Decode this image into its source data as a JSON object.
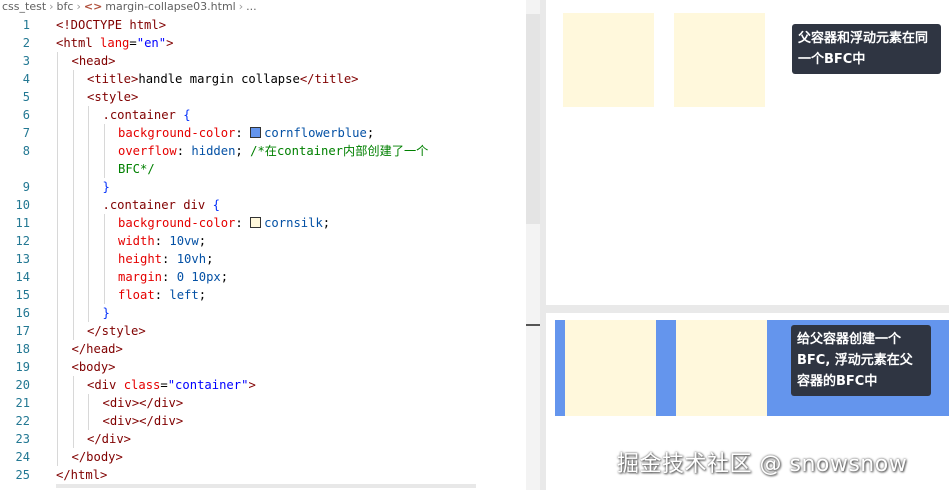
{
  "breadcrumb": {
    "items": [
      "css_test",
      "bfc",
      "margin-collapse03.html",
      "..."
    ],
    "file_icon": "<>"
  },
  "code_lines": [
    {
      "n": "1",
      "tokens": [
        [
          "tag",
          "<!DOCTYPE html>"
        ]
      ]
    },
    {
      "n": "2",
      "tokens": [
        [
          "tag",
          "<html "
        ],
        [
          "attr",
          "lang"
        ],
        [
          "pun",
          "="
        ],
        [
          "str",
          "\"en\""
        ],
        [
          "tag",
          ">"
        ]
      ]
    },
    {
      "n": "3",
      "tokens": [
        [
          "tag",
          "<head>"
        ]
      ]
    },
    {
      "n": "4",
      "tokens": [
        [
          "tag",
          "<title>"
        ],
        [
          "pun",
          "handle margin collapse"
        ],
        [
          "tag",
          "</title>"
        ]
      ]
    },
    {
      "n": "5",
      "tokens": [
        [
          "tag",
          "<style>"
        ]
      ]
    },
    {
      "n": "6",
      "tokens": [
        [
          "sel",
          ".container "
        ],
        [
          "brk",
          "{"
        ]
      ]
    },
    {
      "n": "7",
      "tokens": [
        [
          "prop",
          "background-color"
        ],
        [
          "pun",
          ": "
        ],
        [
          "swatch",
          "#6495ed"
        ],
        [
          "val",
          "cornflowerblue"
        ],
        [
          "pun",
          ";"
        ]
      ]
    },
    {
      "n": "8",
      "tokens": [
        [
          "prop",
          "overflow"
        ],
        [
          "pun",
          ": "
        ],
        [
          "val",
          "hidden"
        ],
        [
          "pun",
          "; "
        ],
        [
          "com",
          "/*在container内部创建了一个"
        ]
      ]
    },
    {
      "n": "",
      "tokens": [
        [
          "com",
          "BFC*/"
        ]
      ]
    },
    {
      "n": "9",
      "tokens": [
        [
          "brk",
          "}"
        ]
      ]
    },
    {
      "n": "10",
      "tokens": [
        [
          "sel",
          ".container div "
        ],
        [
          "brk",
          "{"
        ]
      ]
    },
    {
      "n": "11",
      "tokens": [
        [
          "prop",
          "background-color"
        ],
        [
          "pun",
          ": "
        ],
        [
          "swatch",
          "#fff8dc"
        ],
        [
          "val",
          "cornsilk"
        ],
        [
          "pun",
          ";"
        ]
      ]
    },
    {
      "n": "12",
      "tokens": [
        [
          "prop",
          "width"
        ],
        [
          "pun",
          ": "
        ],
        [
          "val",
          "10vw"
        ],
        [
          "pun",
          ";"
        ]
      ]
    },
    {
      "n": "13",
      "tokens": [
        [
          "prop",
          "height"
        ],
        [
          "pun",
          ": "
        ],
        [
          "val",
          "10vh"
        ],
        [
          "pun",
          ";"
        ]
      ]
    },
    {
      "n": "14",
      "tokens": [
        [
          "prop",
          "margin"
        ],
        [
          "pun",
          ": "
        ],
        [
          "val",
          "0 10px"
        ],
        [
          "pun",
          ";"
        ]
      ]
    },
    {
      "n": "15",
      "tokens": [
        [
          "prop",
          "float"
        ],
        [
          "pun",
          ": "
        ],
        [
          "val",
          "left"
        ],
        [
          "pun",
          ";"
        ]
      ]
    },
    {
      "n": "16",
      "tokens": [
        [
          "brk",
          "}"
        ]
      ]
    },
    {
      "n": "17",
      "tokens": [
        [
          "tag",
          "</style>"
        ]
      ]
    },
    {
      "n": "18",
      "tokens": [
        [
          "tag",
          "</head>"
        ]
      ]
    },
    {
      "n": "19",
      "tokens": [
        [
          "tag",
          "<body>"
        ]
      ]
    },
    {
      "n": "20",
      "tokens": [
        [
          "tag",
          "<div "
        ],
        [
          "attr",
          "class"
        ],
        [
          "pun",
          "="
        ],
        [
          "str",
          "\"container\""
        ],
        [
          "tag",
          ">"
        ]
      ]
    },
    {
      "n": "21",
      "tokens": [
        [
          "tag",
          "<div></div>"
        ]
      ]
    },
    {
      "n": "22",
      "tokens": [
        [
          "tag",
          "<div></div>"
        ]
      ]
    },
    {
      "n": "23",
      "tokens": [
        [
          "tag",
          "</div>"
        ]
      ]
    },
    {
      "n": "24",
      "tokens": [
        [
          "tag",
          "</body>"
        ]
      ]
    },
    {
      "n": "25",
      "tokens": [
        [
          "tag",
          "</html>"
        ]
      ]
    }
  ],
  "preview_top": {
    "label": "父容器和浮动元素在同一个BFC中"
  },
  "preview_bottom": {
    "label": "给父容器创建一个BFC, 浮动元素在父容器的BFC中"
  },
  "watermark": "掘金技术社区 @ snowsnow",
  "colors": {
    "cornflowerblue": "#6495ed",
    "cornsilk": "#fff8dc",
    "tip_bg": "#2f3542"
  }
}
